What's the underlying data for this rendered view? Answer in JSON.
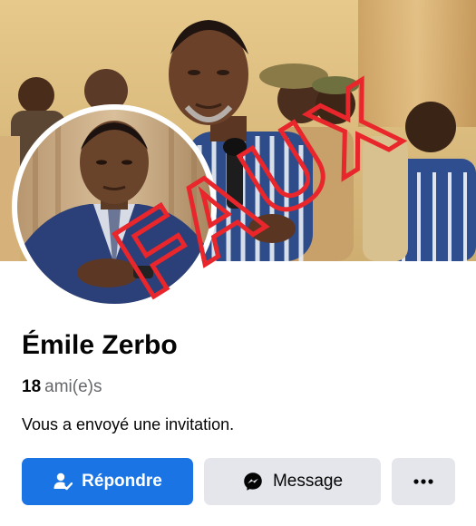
{
  "profile": {
    "name": "Émile Zerbo",
    "friends_count": "18",
    "friends_label": "ami(e)s",
    "invitation_text": "Vous a envoyé une invitation."
  },
  "stamp": {
    "text": "FAUX",
    "color": "#e8262b"
  },
  "actions": {
    "respond_label": "Répondre",
    "respond_icon": "person-check-icon",
    "message_label": "Message",
    "message_icon": "messenger-icon",
    "more_label": "···",
    "more_icon": "more-icon"
  },
  "colors": {
    "primary": "#1b74e4",
    "secondary_button": "#e4e6eb",
    "text": "#050505",
    "muted_text": "#65676b"
  }
}
